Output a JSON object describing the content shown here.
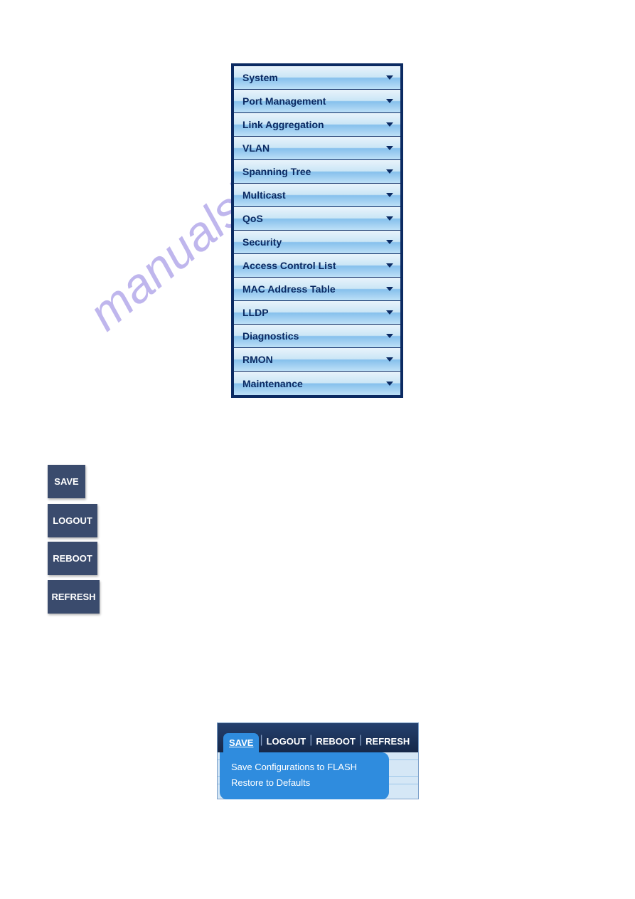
{
  "watermark_text": "manualshive.com",
  "nav": {
    "items": [
      {
        "label": "System"
      },
      {
        "label": "Port Management"
      },
      {
        "label": "Link Aggregation"
      },
      {
        "label": "VLAN"
      },
      {
        "label": "Spanning Tree"
      },
      {
        "label": "Multicast"
      },
      {
        "label": "QoS"
      },
      {
        "label": "Security"
      },
      {
        "label": "Access Control List"
      },
      {
        "label": "MAC Address Table"
      },
      {
        "label": "LLDP"
      },
      {
        "label": "Diagnostics"
      },
      {
        "label": "RMON"
      },
      {
        "label": "Maintenance"
      }
    ]
  },
  "buttons": {
    "save": "SAVE",
    "logout": "LOGOUT",
    "reboot": "REBOOT",
    "refresh": "REFRESH"
  },
  "toolbar": {
    "tabs": {
      "save": "SAVE",
      "logout": "LOGOUT",
      "reboot": "REBOOT",
      "refresh": "REFRESH"
    },
    "dropdown": {
      "item1": "Save Configurations to FLASH",
      "item2": "Restore to Defaults"
    }
  }
}
